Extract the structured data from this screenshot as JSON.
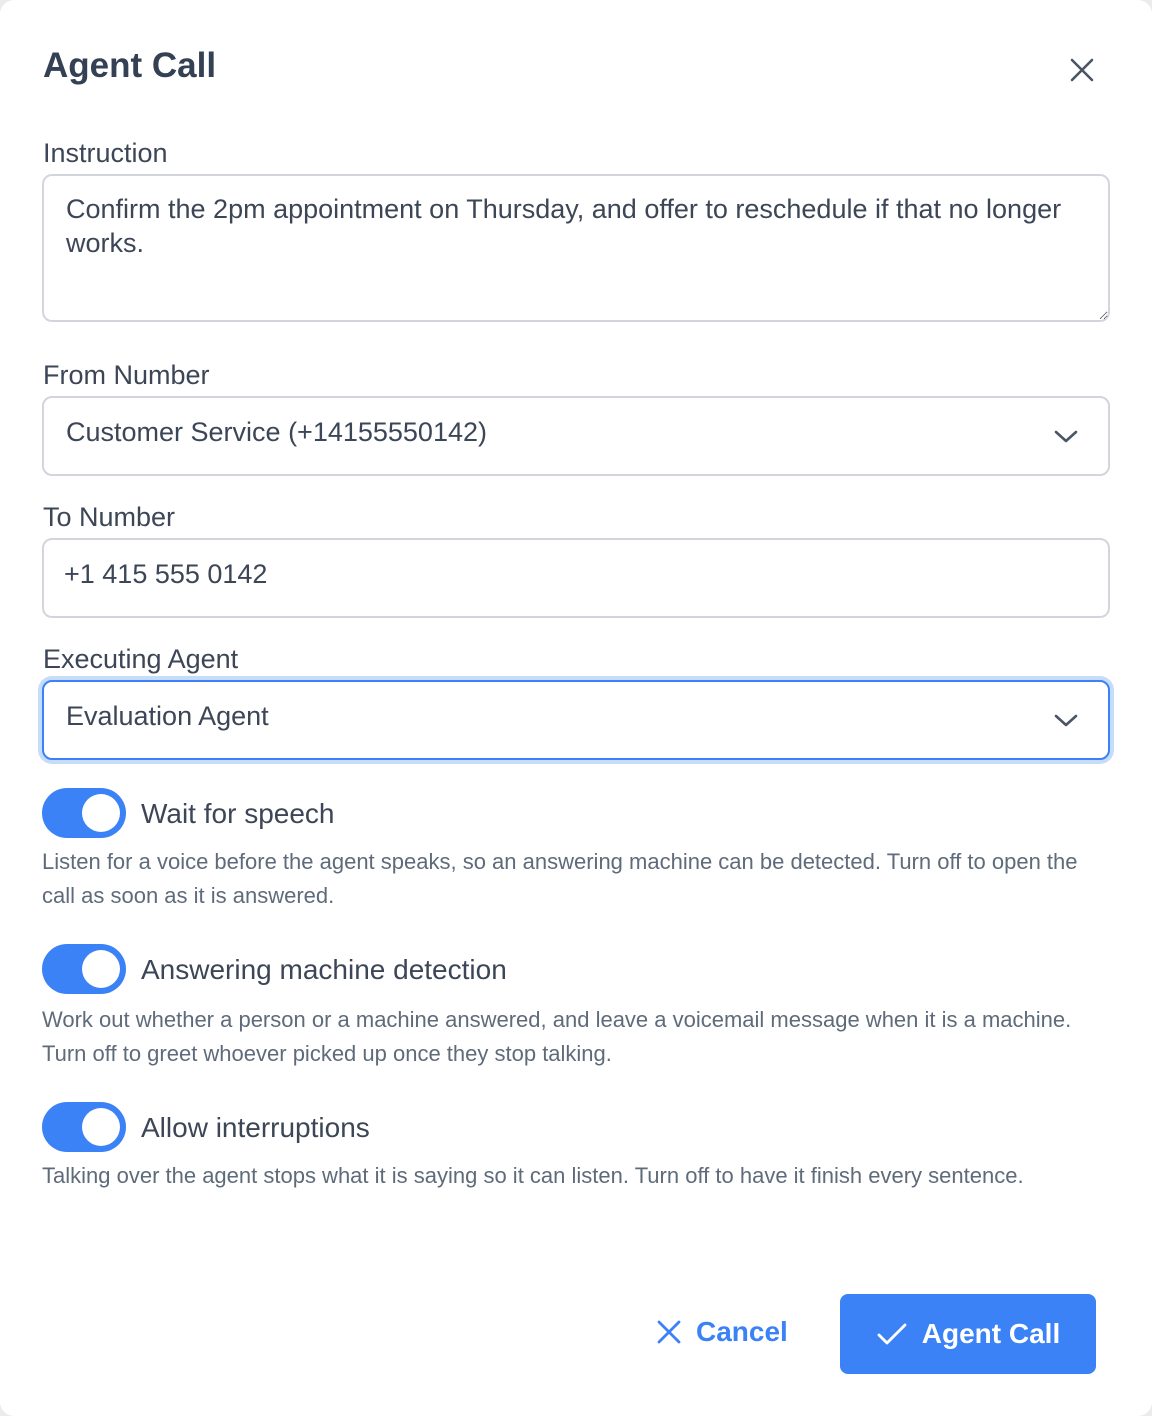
{
  "dialog": {
    "title": "Agent Call"
  },
  "instruction": {
    "label": "Instruction",
    "value": "Confirm the 2pm appointment on Thursday, and offer to reschedule if that no longer works."
  },
  "from_number": {
    "label": "From Number",
    "value": "Customer Service (+14155550142)"
  },
  "to_number": {
    "label": "To Number",
    "value": "+1 415 555 0142"
  },
  "executing_agent": {
    "label": "Executing Agent",
    "value": "Evaluation Agent"
  },
  "toggles": [
    {
      "label": "Wait for speech",
      "on": true,
      "help": "Listen for a voice before the agent speaks, so an answering machine can be detected. Turn off to open the call as soon as it is answered."
    },
    {
      "label": "Answering machine detection",
      "on": true,
      "help": "Work out whether a person or a machine answered, and leave a voicemail message when it is a machine. Turn off to greet whoever picked up once they stop talking."
    },
    {
      "label": "Allow interruptions",
      "on": true,
      "help": "Talking over the agent stops what it is saying so it can listen. Turn off to have it finish every sentence."
    }
  ],
  "footer": {
    "cancel_label": "Cancel",
    "submit_label": "Agent Call"
  },
  "icons": {
    "close": "close-icon",
    "chevron": "chevron-down-icon",
    "cancel": "x-icon",
    "submit": "check-icon"
  },
  "colors": {
    "accent": "#3b82f6",
    "text": "#3c4656",
    "muted": "#5f6b7a",
    "border": "#d2d6dc"
  }
}
